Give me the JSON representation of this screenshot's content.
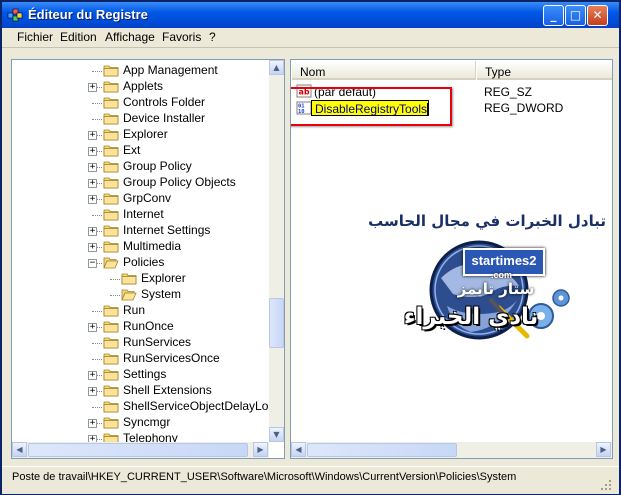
{
  "window": {
    "title": "Éditeur du Registre"
  },
  "menu": [
    {
      "label": "Fichier"
    },
    {
      "label": "Edition"
    },
    {
      "label": "Affichage"
    },
    {
      "label": "Favoris"
    },
    {
      "label": "?"
    }
  ],
  "tree": {
    "items": [
      {
        "label": "App Management",
        "expander": "",
        "open": false
      },
      {
        "label": "Applets",
        "expander": "+",
        "open": false
      },
      {
        "label": "Controls Folder",
        "expander": "",
        "open": false
      },
      {
        "label": "Device Installer",
        "expander": "",
        "open": false
      },
      {
        "label": "Explorer",
        "expander": "+",
        "open": false
      },
      {
        "label": "Ext",
        "expander": "+",
        "open": false
      },
      {
        "label": "Group Policy",
        "expander": "+",
        "open": false
      },
      {
        "label": "Group Policy Objects",
        "expander": "+",
        "open": false
      },
      {
        "label": "GrpConv",
        "expander": "+",
        "open": false
      },
      {
        "label": "Internet",
        "expander": "",
        "open": false
      },
      {
        "label": "Internet Settings",
        "expander": "+",
        "open": false
      },
      {
        "label": "Multimedia",
        "expander": "+",
        "open": false
      },
      {
        "label": "Policies",
        "expander": "−",
        "open": true
      },
      {
        "label": "Explorer",
        "expander": "",
        "open": false,
        "child": true
      },
      {
        "label": "System",
        "expander": "",
        "open": true,
        "child": true
      },
      {
        "label": "Run",
        "expander": "",
        "open": false
      },
      {
        "label": "RunOnce",
        "expander": "+",
        "open": false
      },
      {
        "label": "RunServices",
        "expander": "",
        "open": false
      },
      {
        "label": "RunServicesOnce",
        "expander": "",
        "open": false
      },
      {
        "label": "Settings",
        "expander": "+",
        "open": false
      },
      {
        "label": "Shell Extensions",
        "expander": "+",
        "open": false
      },
      {
        "label": "ShellServiceObjectDelayLoad",
        "expander": "",
        "open": false
      },
      {
        "label": "Syncmgr",
        "expander": "+",
        "open": false
      },
      {
        "label": "Telephony",
        "expander": "+",
        "open": false
      }
    ]
  },
  "list": {
    "columns": {
      "name": "Nom",
      "type": "Type"
    },
    "rows": [
      {
        "name": "(par défaut)",
        "type": "REG_SZ",
        "icon": "string-value-icon"
      },
      {
        "name": "DisableRegistryTools",
        "type": "REG_DWORD",
        "icon": "binary-value-icon",
        "editing": true
      }
    ]
  },
  "watermark": {
    "line1": "تبادل الخبرات في مجال الحاسب",
    "badge": "startimes2",
    "badge_sub": ".com",
    "line2": "ستار تايمز",
    "line3": "نادي الخبراء"
  },
  "status": {
    "path": "Poste de travail\\HKEY_CURRENT_USER\\Software\\Microsoft\\Windows\\CurrentVersion\\Policies\\System"
  },
  "colors": {
    "title_blue": "#0058e6",
    "highlight_red": "#e8000b",
    "edit_yellow": "#ffff00"
  }
}
